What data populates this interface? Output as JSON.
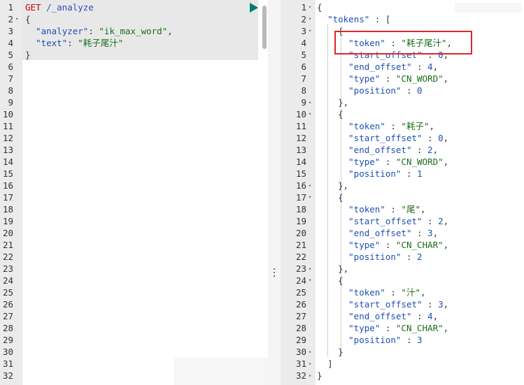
{
  "request_editor": {
    "lines": [
      {
        "num": "1",
        "method": "GET",
        "path": "/_analyze"
      },
      {
        "num": "2",
        "text": "{"
      },
      {
        "num": "3",
        "key": "\"analyzer\"",
        "sep": ": ",
        "val": "\"ik_max_word\"",
        "tail": ","
      },
      {
        "num": "4",
        "key": "\"text\"",
        "sep": ": ",
        "val": "\"耗子尾汁\"",
        "tail": ""
      },
      {
        "num": "5",
        "text": "}"
      }
    ],
    "line_numbers": [
      "1",
      "2",
      "3",
      "4",
      "5",
      "6",
      "7",
      "8",
      "9",
      "10",
      "11",
      "12",
      "13",
      "14",
      "15",
      "16",
      "17",
      "18",
      "19",
      "20",
      "21",
      "22",
      "23",
      "24",
      "25",
      "26",
      "27",
      "28",
      "29",
      "30",
      "31",
      "32"
    ],
    "run_icon": "play-icon",
    "settings_icon": "wrench-icon"
  },
  "response_viewer": {
    "line_numbers": [
      "1",
      "2",
      "3",
      "4",
      "5",
      "6",
      "7",
      "8",
      "9",
      "10",
      "11",
      "12",
      "13",
      "14",
      "15",
      "16",
      "17",
      "18",
      "19",
      "20",
      "21",
      "22",
      "23",
      "24",
      "25",
      "26",
      "27",
      "28",
      "29",
      "30",
      "31",
      "32"
    ],
    "fold_lines": [
      "1",
      "2",
      "3",
      "9",
      "10",
      "16",
      "17",
      "23",
      "24",
      "30",
      "31",
      "32"
    ],
    "root_open": "{",
    "tokens_key": "\"tokens\"",
    "tokens_open": " : [",
    "tokens_close": "]",
    "root_close": "}",
    "tokens": [
      {
        "token": "\"耗子尾汁\"",
        "start_offset": "0",
        "end_offset": "4",
        "type": "\"CN_WORD\"",
        "position": "0"
      },
      {
        "token": "\"耗子\"",
        "start_offset": "0",
        "end_offset": "2",
        "type": "\"CN_WORD\"",
        "position": "1"
      },
      {
        "token": "\"尾\"",
        "start_offset": "2",
        "end_offset": "3",
        "type": "\"CN_CHAR\"",
        "position": "2"
      },
      {
        "token": "\"汁\"",
        "start_offset": "3",
        "end_offset": "4",
        "type": "\"CN_CHAR\"",
        "position": "3"
      }
    ],
    "field_keys": {
      "token": "\"token\"",
      "start_offset": "\"start_offset\"",
      "end_offset": "\"end_offset\"",
      "type": "\"type\"",
      "position": "\"position\""
    }
  },
  "colors": {
    "method": "#c5060b",
    "key": "#1d4fb4",
    "string": "#1a6d1a",
    "highlight": "#d9272e",
    "run": "#017d73"
  }
}
